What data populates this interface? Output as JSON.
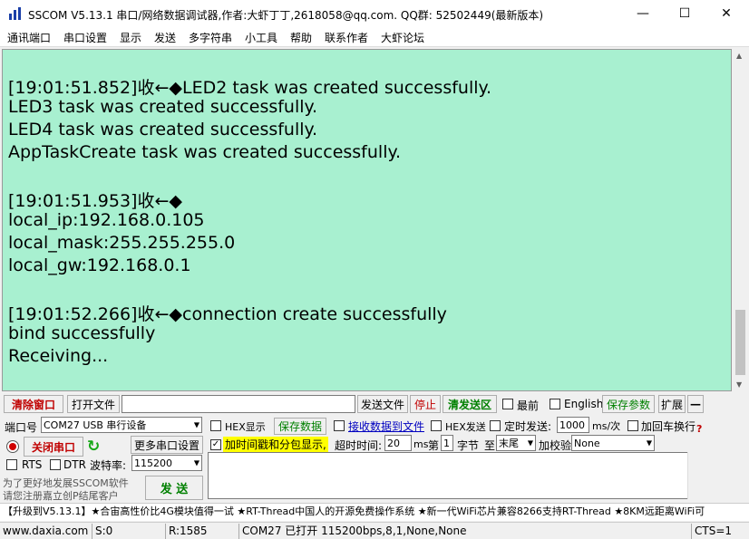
{
  "window": {
    "title": "SSCOM V5.13.1 串口/网络数据调试器,作者:大虾丁丁,2618058@qq.com. QQ群: 52502449(最新版本)",
    "minimize": "—",
    "maximize": "☐",
    "close": "✕"
  },
  "menu": [
    "通讯端口",
    "串口设置",
    "显示",
    "发送",
    "多字符串",
    "小工具",
    "帮助",
    "联系作者",
    "大虾论坛"
  ],
  "receive": {
    "lines": [
      "[19:01:51.852]收←◆LED2 task was created successfully.",
      "LED3 task was created successfully.",
      "LED4 task was created successfully.",
      "AppTaskCreate task was created successfully.",
      "",
      "[19:01:51.953]收←◆",
      "local_ip:192.168.0.105",
      "local_mask:255.255.255.0",
      "local_gw:192.168.0.1",
      "",
      "[19:01:52.266]收←◆connection create successfully",
      "bind successfully",
      "Receiving..."
    ]
  },
  "toolbar": {
    "clear": "清除窗口",
    "open_file": "打开文件",
    "file_path": "",
    "send_file": "发送文件",
    "stop": "停止",
    "clear_send": "清发送区",
    "topmost": "最前",
    "english": "English",
    "save_params": "保存参数",
    "expand": "扩展",
    "collapse": "—"
  },
  "port": {
    "label": "端口号",
    "value": "COM27 USB 串行设备",
    "close_btn": "关闭串口",
    "more_settings": "更多串口设置",
    "rts": "RTS",
    "dtr": "DTR",
    "baud_label": "波特率:",
    "baud_value": "115200"
  },
  "options": {
    "hex_display": "HEX显示",
    "save_data": "保存数据",
    "recv_to_file": "接收数据到文件",
    "hex_send": "HEX发送",
    "timed_send": "定时发送:",
    "interval": "1000",
    "interval_unit": "ms/次",
    "add_crlf": "加回车换行",
    "timestamp": "加时间戳和分包显示,",
    "timeout_label": "超时时间:",
    "timeout_value": "20",
    "timeout_unit": "ms",
    "byte_prefix": "第",
    "byte_num": "1",
    "byte_label": "字节",
    "to_label": "至",
    "to_value": "末尾",
    "checksum_label": "加校验",
    "checksum_value": "None"
  },
  "promo": {
    "line1": "为了更好地发展SSCOM软件",
    "line2": "请您注册嘉立创P结尾客户",
    "send": "发 送"
  },
  "ticker": "【升级到V5.13.1】★合宙高性价比4G模块值得一试 ★RT-Thread中国人的开源免费操作系统 ★新一代WiFi芯片兼容8266支持RT-Thread ★8KM远距离WiFi可",
  "status": {
    "site": "www.daxia.com",
    "sent": "S:0",
    "received": "R:1585",
    "port_info": "COM27 已打开  115200bps,8,1,None,None",
    "cts": "CTS=1"
  },
  "colors": {
    "receive_bg": "#a8f0d0",
    "accent_red": "#c00000",
    "accent_green": "#008000",
    "timestamp_bg": "#ffff00"
  }
}
